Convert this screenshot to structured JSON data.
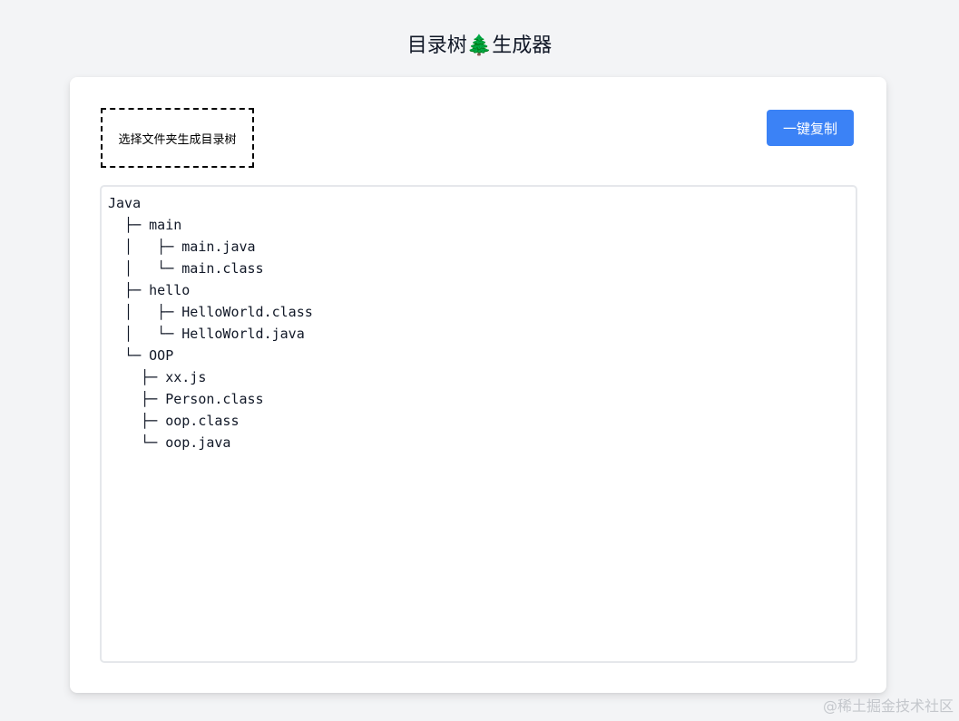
{
  "header": {
    "title": "目录树🌲生成器"
  },
  "toolbar": {
    "picker_label": "选择文件夹生成目录树",
    "copy_label": "一键复制"
  },
  "tree": {
    "text": "Java\n  ├─ main\n  │   ├─ main.java\n  │   └─ main.class\n  ├─ hello\n  │   ├─ HelloWorld.class\n  │   └─ HelloWorld.java\n  └─ OOP\n    ├─ xx.js\n    ├─ Person.class\n    ├─ oop.class\n    └─ oop.java"
  },
  "watermark": {
    "text": "@稀土掘金技术社区"
  },
  "colors": {
    "accent": "#3b82f6",
    "background": "#f3f4f6",
    "card": "#ffffff"
  }
}
